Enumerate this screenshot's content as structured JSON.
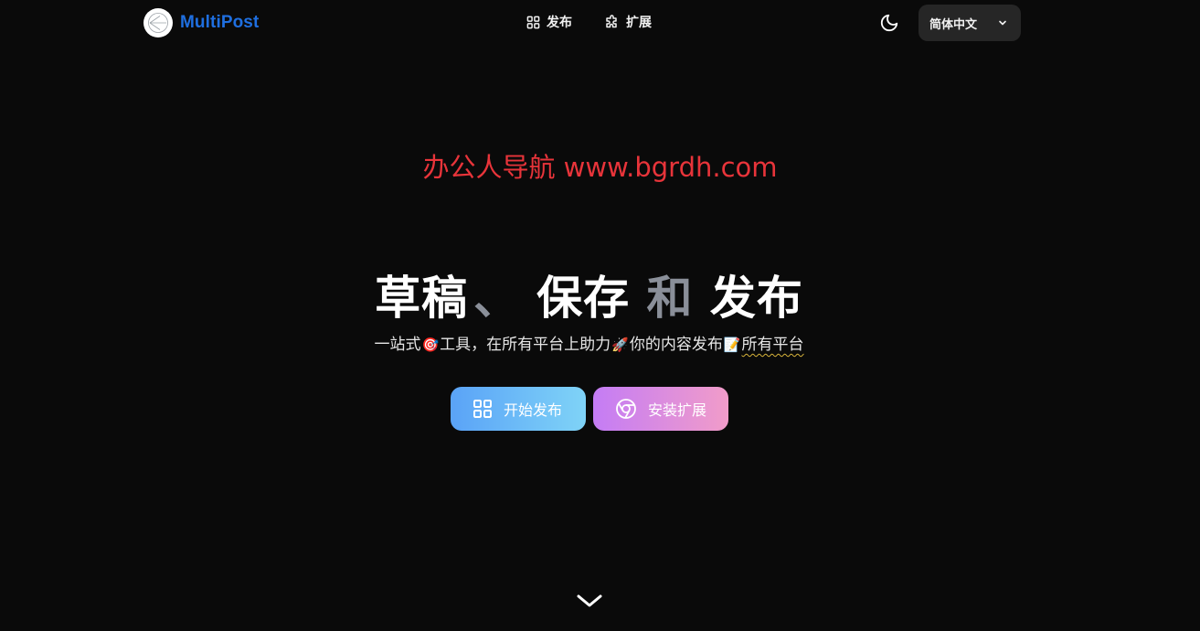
{
  "header": {
    "brand_name": "MultiPost",
    "nav": [
      {
        "label": "发布",
        "icon": "grid-icon"
      },
      {
        "label": "扩展",
        "icon": "puzzle-icon"
      }
    ],
    "theme_icon": "moon-icon",
    "language": {
      "selected": "简体中文",
      "icon": "chevron-down-icon"
    }
  },
  "watermark": "办公人导航 www.bgrdh.com",
  "hero": {
    "title_part1": "草稿",
    "title_sep": "、",
    "title_part2": "保存",
    "title_connector": "和",
    "title_part3": "发布",
    "subtitle": {
      "seg1": "一站式",
      "emoji1": "🎯",
      "seg2": "工具，在所有平台上助力",
      "emoji2": "🚀",
      "seg3": "你的内容发布",
      "emoji3": "📝",
      "seg4": "所有平台"
    }
  },
  "cta": {
    "primary": {
      "label": "开始发布",
      "icon": "grid-icon"
    },
    "secondary": {
      "label": "安装扩展",
      "icon": "chrome-icon"
    }
  },
  "scroll_icon": "chevron-down-icon",
  "colors": {
    "background": "#0a0a0a",
    "brand": "#1f6fe0",
    "watermark": "#e8343a",
    "primary_gradient": [
      "#5aa3f7",
      "#7fd3f7"
    ],
    "secondary_gradient": [
      "#c47cf5",
      "#f19cc9"
    ]
  }
}
